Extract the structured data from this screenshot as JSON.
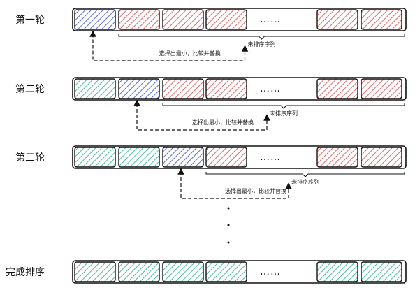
{
  "rounds": [
    {
      "label": "第一轮",
      "cells": [
        "blue",
        "red",
        "red",
        "red",
        "gap",
        "red",
        "red"
      ],
      "note": "选择出最小，比较并替换",
      "unsorted_label": "未排序序列",
      "has_arrow": true
    },
    {
      "label": "第二轮",
      "cells": [
        "green",
        "blue",
        "red",
        "red",
        "gap",
        "red",
        "red"
      ],
      "note": "选择出最小，比较并替换",
      "unsorted_label": "未排序序列",
      "has_arrow": true
    },
    {
      "label": "第三轮",
      "cells": [
        "green",
        "green",
        "blue",
        "red",
        "gap",
        "red",
        "red"
      ],
      "note": "选择出最小，比较并替换",
      "unsorted_label": "未排序序列",
      "has_arrow": true
    },
    {
      "label": "完成排序",
      "cells": [
        "green",
        "green",
        "green",
        "green",
        "gap",
        "green",
        "green"
      ],
      "has_arrow": false
    }
  ],
  "ellipsis": "……",
  "colors": {
    "blue": "#5b6fd6",
    "red": "#e06b6b",
    "green": "#4fbf9a",
    "outline": "#111111"
  }
}
